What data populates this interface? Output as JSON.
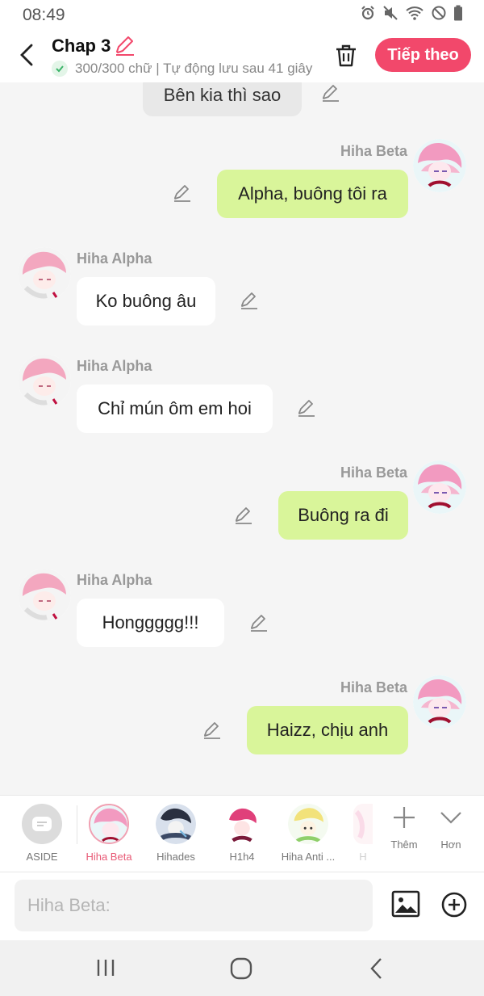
{
  "status_bar": {
    "time": "08:49",
    "icons": [
      "alarm-icon",
      "mute-icon",
      "wifi-icon",
      "no-disturb-icon",
      "battery-icon"
    ]
  },
  "header": {
    "back_icon": "chevron-left-icon",
    "title": "Chap 3",
    "subtitle": "300/300 chữ | Tự động lưu sau 41 giây",
    "next_label": "Tiếp theo",
    "accent_color": "#f2486b"
  },
  "chat": {
    "aside_text": "Bên kia thì sao",
    "messages": [
      {
        "sender": "Hiha Beta",
        "side": "right",
        "text": "Alpha, buông tôi ra"
      },
      {
        "sender": "Hiha Alpha",
        "side": "left",
        "text": "Ko buông âu"
      },
      {
        "sender": "Hiha Alpha",
        "side": "left",
        "text": "Chỉ mún ôm em hoi"
      },
      {
        "sender": "Hiha Beta",
        "side": "right",
        "text": "Buông ra đi"
      },
      {
        "sender": "Hiha Alpha",
        "side": "left",
        "text": "Honggggg!!!"
      },
      {
        "sender": "Hiha Beta",
        "side": "right",
        "text": "Haizz, chịu anh"
      }
    ]
  },
  "characters": {
    "aside_label": "ASIDE",
    "items": [
      {
        "label": "Hiha Beta",
        "active": true
      },
      {
        "label": "Hihades",
        "active": false
      },
      {
        "label": "H1h4",
        "active": false
      },
      {
        "label": "Hiha Anti ...",
        "active": false
      },
      {
        "label": "H",
        "active": false
      }
    ],
    "more_label": "Thêm",
    "less_label": "Hơn"
  },
  "composer": {
    "placeholder": "Hiha Beta:"
  },
  "colors": {
    "right_bubble": "#d9f59a",
    "left_bubble": "#ffffff",
    "active_label": "#e85a76"
  }
}
